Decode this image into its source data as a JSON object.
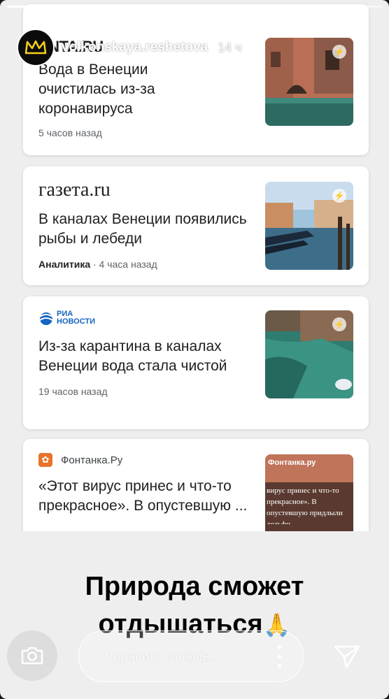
{
  "story": {
    "username": "volkonskaya.reshetova",
    "time": "14 ч",
    "segments_total": 13,
    "segments_done": 8
  },
  "cards": [
    {
      "source": "LENTA.RU",
      "source_display": "ENTA.RU",
      "headline": "Вода в Венеции очистилась из-за коронавируса",
      "meta": "5 часов назад"
    },
    {
      "source": "газета.ru",
      "headline": "В каналах Венеции появились рыбы и лебеди",
      "meta_category": "Аналитика",
      "meta": " · 4 часа назад"
    },
    {
      "source_top": "РИА",
      "source_bottom": "НОВОСТИ",
      "headline": "Из-за карантина в каналах Венеции вода стала чистой",
      "meta": "19 часов назад"
    },
    {
      "source": "Фонтанка.Ру",
      "headline": "«Этот вирус принес и что-то прекрасное». В опустевшую ...",
      "thumb_caption": "вирус принес и что-то прекрасное». В опустевшую придлыли дельфи",
      "thumb_brand": "Фонтанка.ру"
    }
  ],
  "caption": {
    "line1": "Природа сможет",
    "line2": "отдышаться",
    "emoji": "🙏"
  },
  "bottom_bar": {
    "message_placeholder": "Отправить сообще...",
    "camera_icon": "camera-icon",
    "send_icon": "send-icon",
    "more_icon": "more-vertical-icon"
  },
  "colors": {
    "background": "#eeeeee",
    "card": "#ffffff",
    "headline": "#202124",
    "meta": "#5f6368",
    "ria_blue": "#1565c0",
    "fontanka_orange": "#e8742a"
  }
}
